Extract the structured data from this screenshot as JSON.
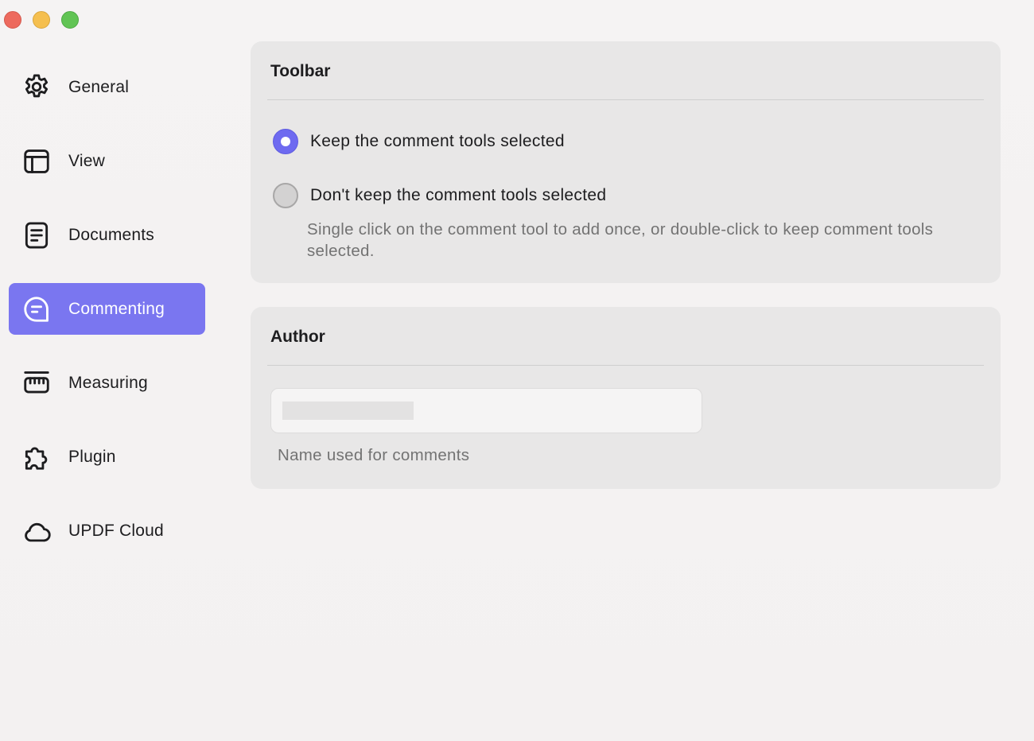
{
  "window": {
    "controls": [
      "close",
      "minimize",
      "maximize"
    ]
  },
  "sidebar": {
    "items": [
      {
        "label": "General",
        "icon": "gear-icon",
        "active": false
      },
      {
        "label": "View",
        "icon": "layout-icon",
        "active": false
      },
      {
        "label": "Documents",
        "icon": "document-icon",
        "active": false
      },
      {
        "label": "Commenting",
        "icon": "comment-icon",
        "active": true
      },
      {
        "label": "Measuring",
        "icon": "ruler-icon",
        "active": false
      },
      {
        "label": "Plugin",
        "icon": "puzzle-icon",
        "active": false
      },
      {
        "label": "UPDF Cloud",
        "icon": "cloud-icon",
        "active": false
      }
    ]
  },
  "toolbar_section": {
    "title": "Toolbar",
    "options": [
      {
        "label": "Keep the comment tools selected",
        "selected": true
      },
      {
        "label": "Don't keep the comment tools selected",
        "selected": false
      }
    ],
    "hint": "Single click on the comment tool to add once, or double-click to keep comment tools selected."
  },
  "author_section": {
    "title": "Author",
    "field_value": "",
    "field_caption": "Name used for comments"
  },
  "colors": {
    "accent": "#7a76f0",
    "panel_bg": "#e8e7e7",
    "window_bg": "#f4f2f2"
  }
}
